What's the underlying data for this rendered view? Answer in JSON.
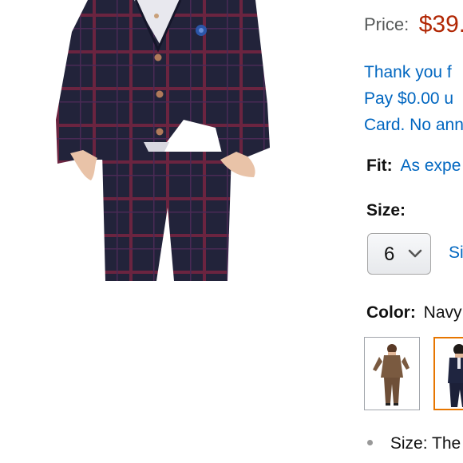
{
  "price": {
    "label": "Price:",
    "value": "$39."
  },
  "promo": {
    "lines": [
      "Thank you f",
      "Pay $0.00 u",
      "Card. No ann"
    ]
  },
  "fit": {
    "label": "Fit:",
    "value": "As expe"
  },
  "size": {
    "label": "Size:",
    "selected": "6",
    "size_chart_link": "Si"
  },
  "color": {
    "label": "Color:",
    "value": "Navy"
  },
  "bullets": [
    {
      "label": "Size:",
      "text": "The"
    }
  ],
  "colors": {
    "price": "#b12704",
    "link": "#0066c0",
    "selected_border": "#e77600"
  },
  "icons": {
    "select_arrow": "chevron-down-icon"
  }
}
